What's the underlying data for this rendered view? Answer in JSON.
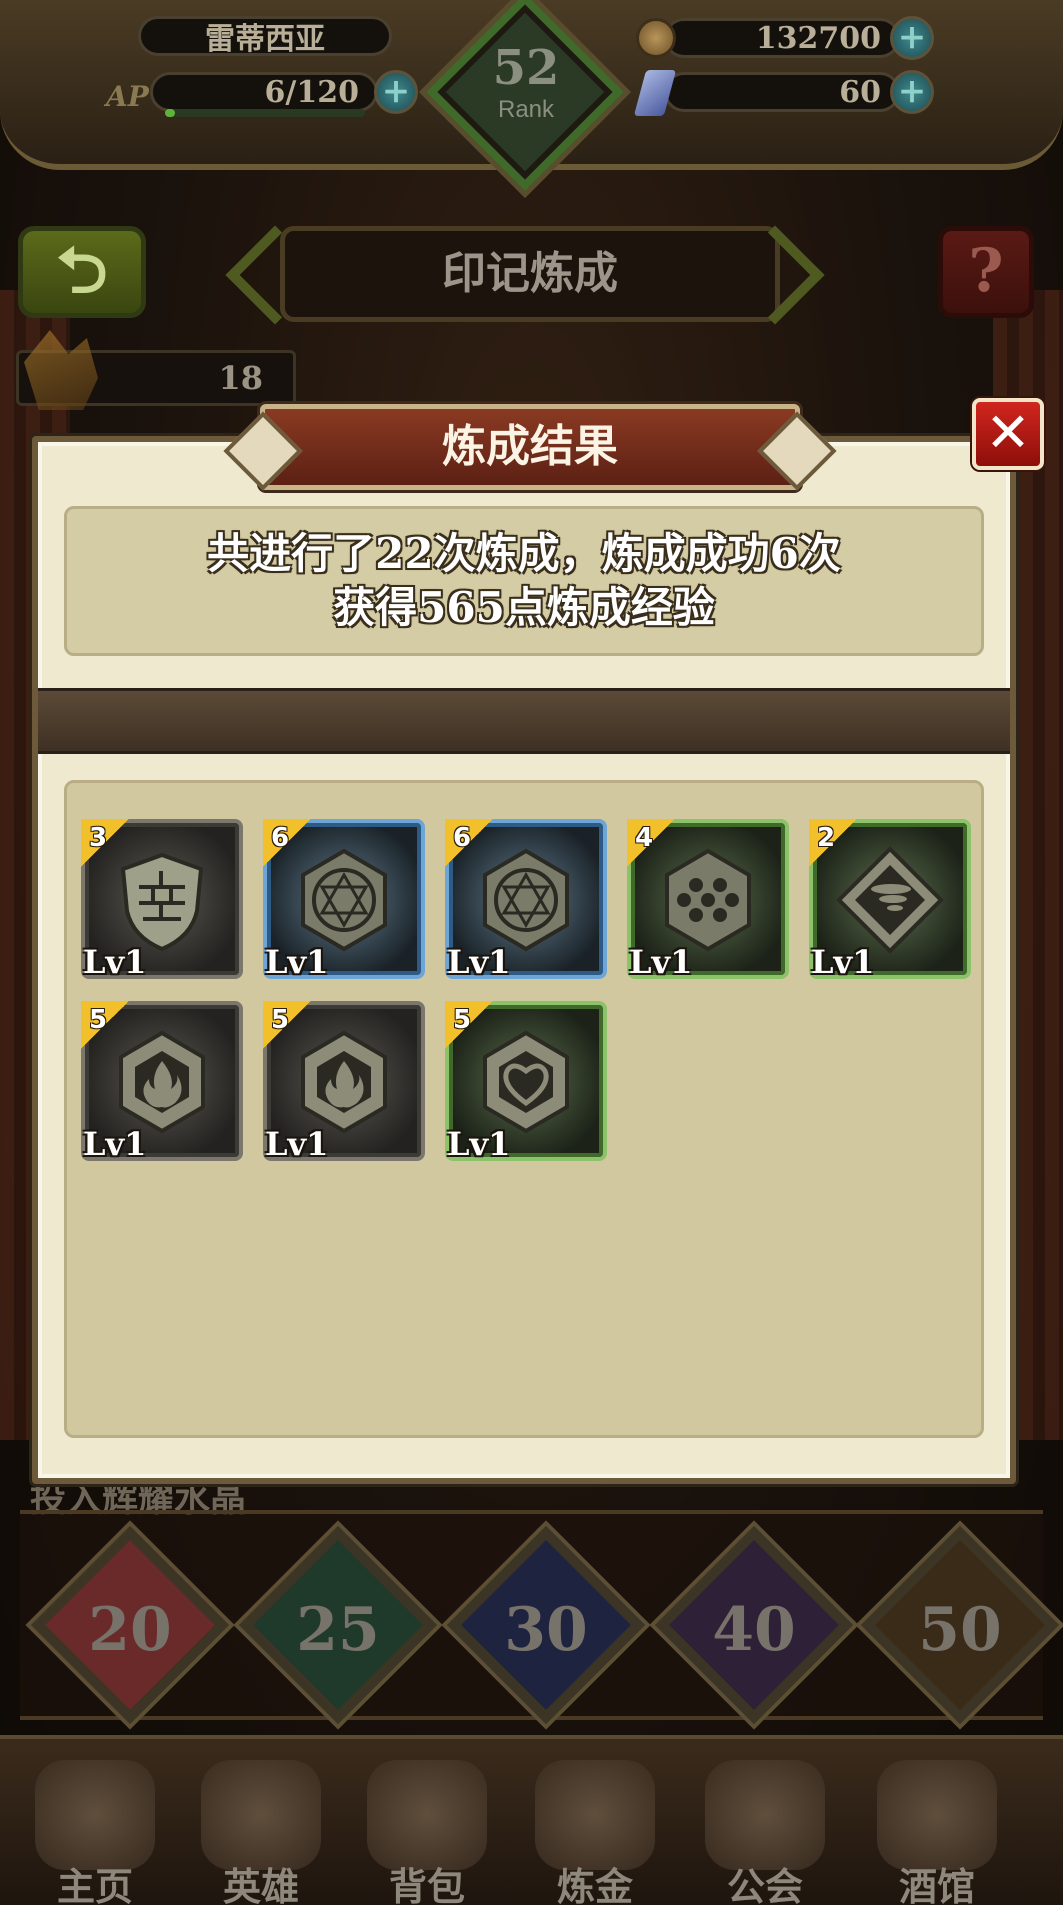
{
  "header": {
    "player_name": "雷蒂西亚",
    "ap_label": "AP",
    "ap_value": "6/120",
    "ap_fill": 0.05,
    "rank_value": "52",
    "rank_label": "Rank",
    "gold": "132700",
    "crystal": "60",
    "plus_symbol": "+"
  },
  "title_bar": {
    "back_symbol": "⮌",
    "title": "印记炼成",
    "help_symbol": "?",
    "ore_count": "18"
  },
  "modal": {
    "title": "炼成结果",
    "close_symbol": "✕",
    "summary_line1": "共进行了22次炼成，炼成成功6次",
    "summary_line2": "获得565点炼成经验",
    "items": [
      {
        "qty": "3",
        "level": "Lv1",
        "frame": "gray",
        "icon": "brick-shield-icon"
      },
      {
        "qty": "6",
        "level": "Lv1",
        "frame": "blue",
        "icon": "hexagram-icon"
      },
      {
        "qty": "6",
        "level": "Lv1",
        "frame": "blue",
        "icon": "hexagram-icon"
      },
      {
        "qty": "4",
        "level": "Lv1",
        "frame": "green",
        "icon": "honeycomb-icon"
      },
      {
        "qty": "2",
        "level": "Lv1",
        "frame": "green",
        "icon": "tornado-icon"
      },
      {
        "qty": "5",
        "level": "Lv1",
        "frame": "gray",
        "icon": "flame-icon"
      },
      {
        "qty": "5",
        "level": "Lv1",
        "frame": "gray",
        "icon": "flame-icon"
      },
      {
        "qty": "5",
        "level": "Lv1",
        "frame": "green",
        "icon": "heart-icon"
      }
    ]
  },
  "behind": {
    "strip_text": "投入辉耀水晶",
    "rune_values": [
      "20",
      "25",
      "30",
      "40",
      "50"
    ],
    "rune_colors": [
      "#6a2a2a",
      "#1f3a2a",
      "#1e2440",
      "#2e2036",
      "#3a2a18"
    ]
  },
  "bottom_nav": {
    "items": [
      "主页",
      "英雄",
      "背包",
      "炼金",
      "公会",
      "酒馆"
    ]
  }
}
